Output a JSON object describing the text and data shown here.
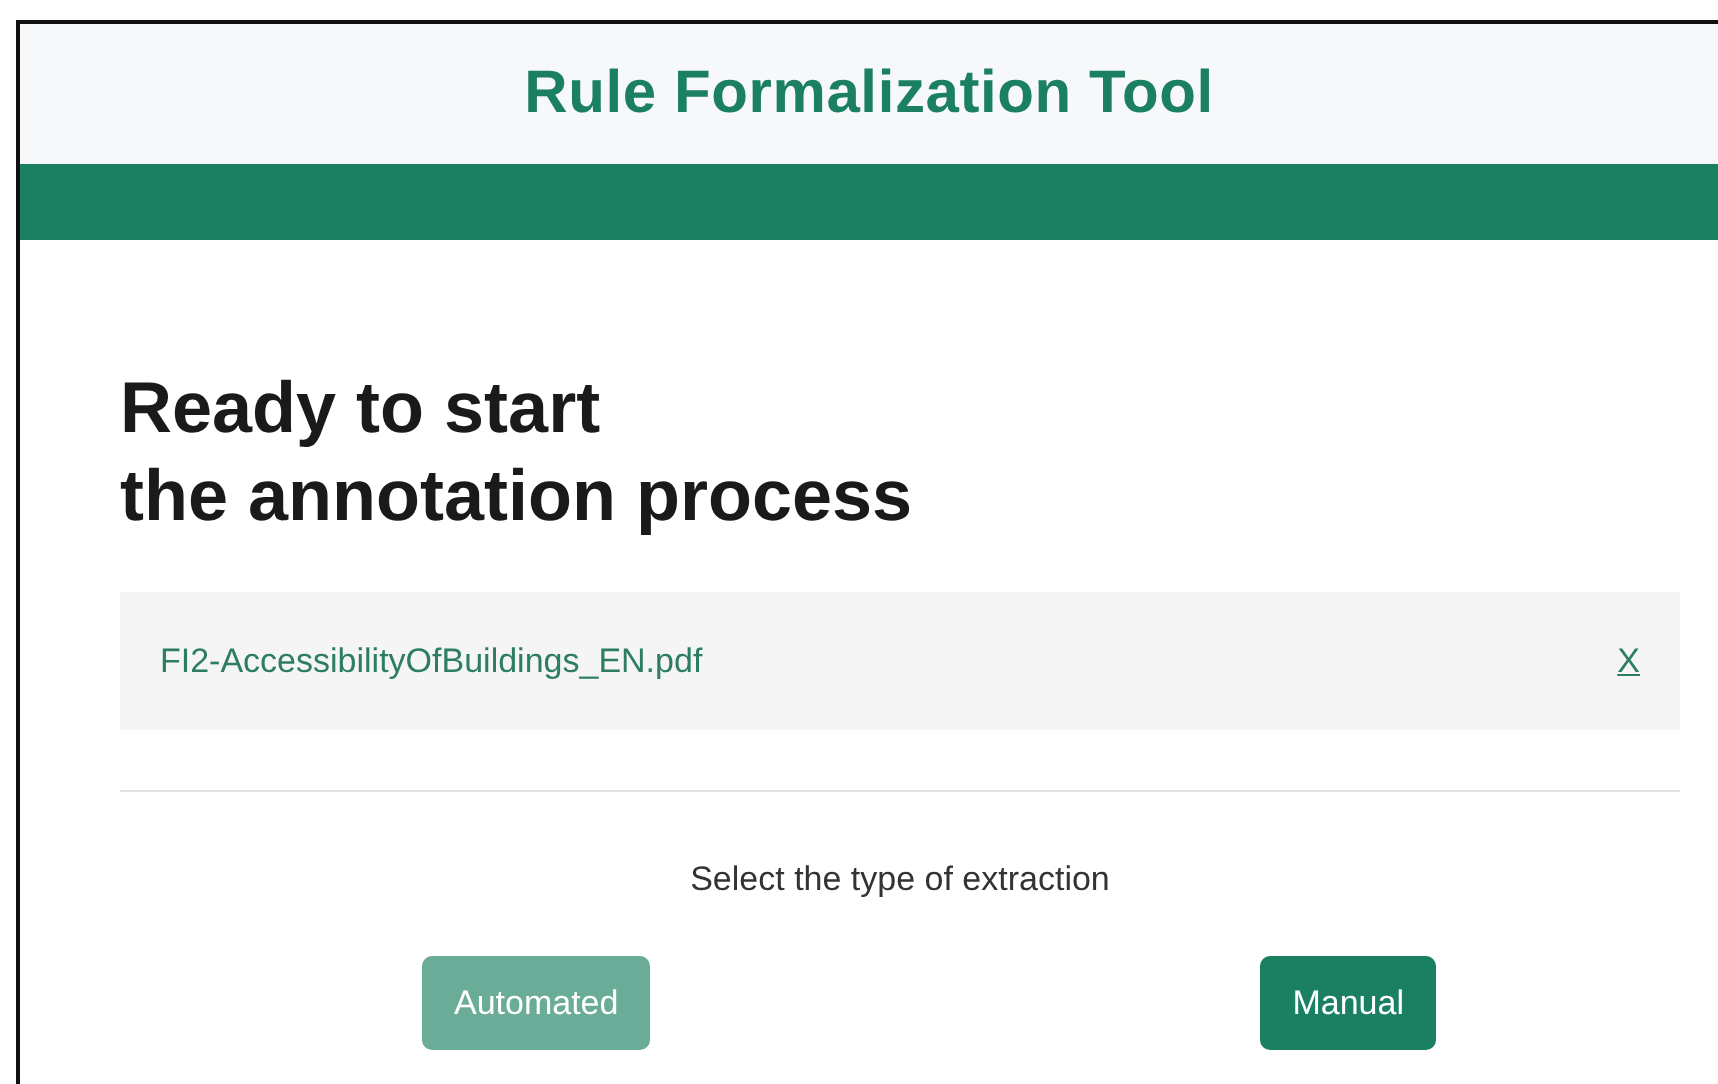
{
  "header": {
    "title": "Rule Formalization Tool"
  },
  "heading": [
    "Ready to start",
    "the annotation process"
  ],
  "file": {
    "name": "FI2-AccessibilityOfBuildings_EN.pdf",
    "remove": "X"
  },
  "prompt": "Select the type of extraction",
  "buttons": [
    {
      "label": "Automated",
      "disabled": true
    },
    {
      "label": "Manual",
      "disabled": false
    }
  ]
}
